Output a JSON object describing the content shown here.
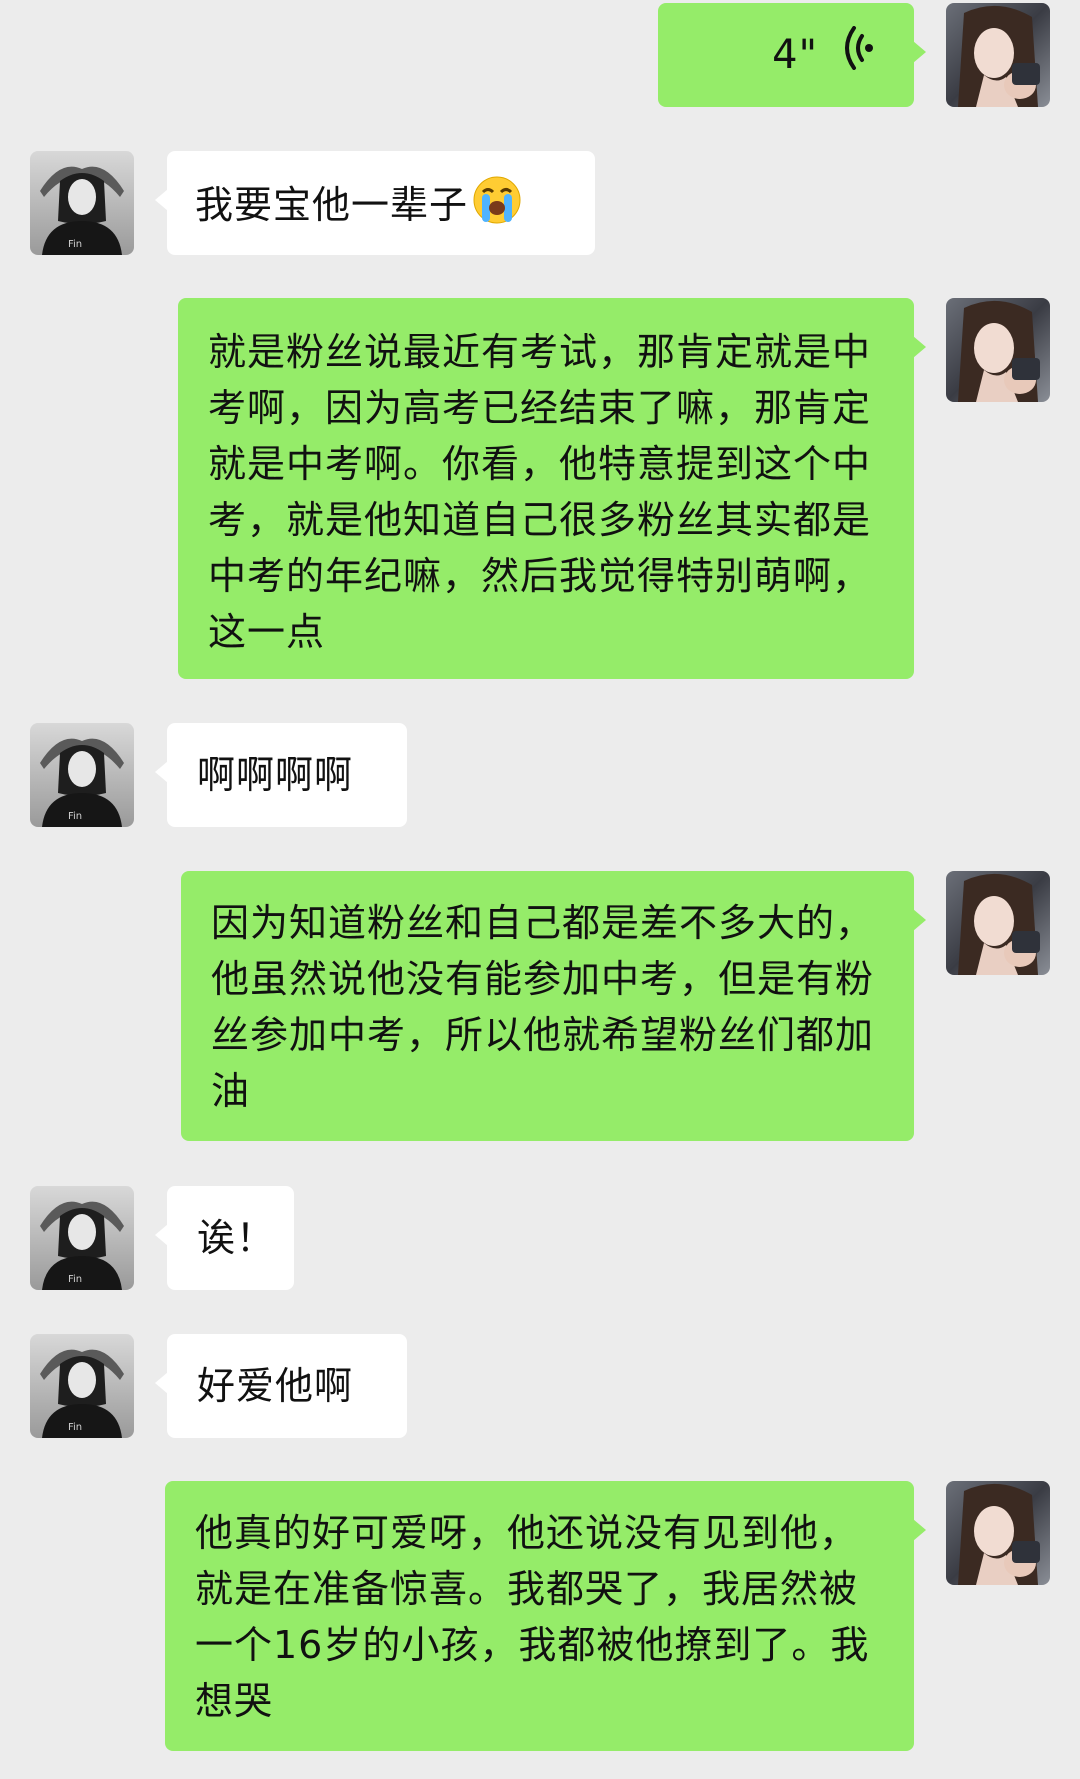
{
  "messages": [
    {
      "side": "right",
      "type": "voice",
      "duration": "4\""
    },
    {
      "side": "left",
      "type": "text",
      "text": "我要宝他一辈子",
      "emoji": "loudly-crying-face"
    },
    {
      "side": "right",
      "type": "text",
      "text": "就是粉丝说最近有考试，那肯定就是中考啊，因为高考已经结束了嘛，那肯定就是中考啊。你看，他特意提到这个中考，就是他知道自己很多粉丝其实都是中考的年纪嘛，然后我觉得特别萌啊，这一点"
    },
    {
      "side": "left",
      "type": "text",
      "text": "啊啊啊啊"
    },
    {
      "side": "right",
      "type": "text",
      "text": "因为知道粉丝和自己都是差不多大的，他虽然说他没有能参加中考，但是有粉丝参加中考，所以他就希望粉丝们都加油"
    },
    {
      "side": "left",
      "type": "text",
      "text": "诶！"
    },
    {
      "side": "left",
      "type": "text",
      "text": "好爱他啊"
    },
    {
      "side": "right",
      "type": "text",
      "text": "他真的好可爱呀，他还说没有见到他，就是在准备惊喜。我都哭了，我居然被一个16岁的小孩，我都被他撩到了。我想哭"
    }
  ],
  "icons": {
    "voice": "voice-wave-icon",
    "left_avatar": "contact-avatar",
    "right_avatar": "self-avatar"
  },
  "colors": {
    "background": "#ececec",
    "sent_bubble": "#95ec69",
    "received_bubble": "#ffffff"
  }
}
